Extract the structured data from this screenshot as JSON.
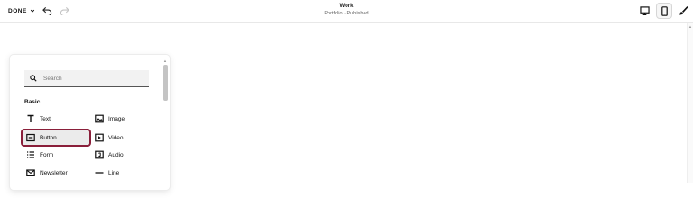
{
  "topbar": {
    "done_label": "DONE",
    "page_title": "Work",
    "page_status": "Portfolio · Published"
  },
  "panel": {
    "search_placeholder": "Search",
    "section_title": "Basic",
    "blocks": [
      {
        "label": "Text",
        "icon": "text-icon"
      },
      {
        "label": "Image",
        "icon": "image-icon"
      },
      {
        "label": "Button",
        "icon": "button-icon",
        "selected": true
      },
      {
        "label": "Video",
        "icon": "video-icon"
      },
      {
        "label": "Form",
        "icon": "form-icon"
      },
      {
        "label": "Audio",
        "icon": "audio-icon"
      },
      {
        "label": "Newsletter",
        "icon": "newsletter-icon"
      },
      {
        "label": "Line",
        "icon": "line-icon"
      }
    ]
  },
  "colors": {
    "selection_border": "#8a1f3a",
    "search_bg": "#f2f2f2"
  }
}
